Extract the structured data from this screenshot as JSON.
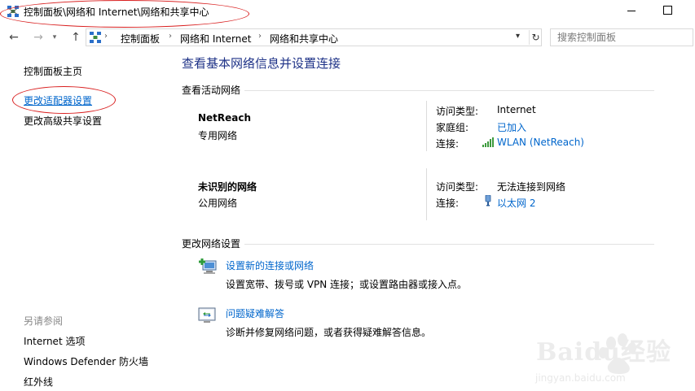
{
  "window": {
    "title": "控制面板\\网络和 Internet\\网络和共享中心"
  },
  "address_bar": {
    "crumbs": [
      "控制面板",
      "网络和 Internet",
      "网络和共享中心"
    ]
  },
  "search": {
    "placeholder": "搜索控制面板"
  },
  "sidebar": {
    "items": [
      {
        "label": "控制面板主页"
      },
      {
        "label": "更改适配器设置"
      },
      {
        "label": "更改高级共享设置"
      }
    ],
    "see_also_title": "另请参阅",
    "see_also": [
      {
        "label": "Internet 选项"
      },
      {
        "label": "Windows Defender 防火墙"
      },
      {
        "label": "红外线"
      }
    ]
  },
  "main": {
    "title": "查看基本网络信息并设置连接",
    "active_networks_title": "查看活动网络",
    "networks": [
      {
        "name": "NetReach",
        "type": "专用网络",
        "access_label": "访问类型:",
        "access_value": "Internet",
        "homegroup_label": "家庭组:",
        "homegroup_value": "已加入",
        "connection_label": "连接:",
        "connection_value": "WLAN (NetReach)"
      },
      {
        "name": "未识别的网络",
        "type": "公用网络",
        "access_label": "访问类型:",
        "access_value": "无法连接到网络",
        "connection_label": "连接:",
        "connection_value": "以太网 2"
      }
    ],
    "change_settings_title": "更改网络设置",
    "tasks": [
      {
        "link": "设置新的连接或网络",
        "desc": "设置宽带、拨号或 VPN 连接；或设置路由器或接入点。"
      },
      {
        "link": "问题疑难解答",
        "desc": "诊断并修复网络问题，或者获得疑难解答信息。"
      }
    ]
  },
  "watermark": {
    "text": "Baidu经验",
    "sub": "jingyan.baidu.com"
  },
  "colors": {
    "link": "#0066cc",
    "heading": "#1e3287",
    "annotation": "#d92020"
  }
}
